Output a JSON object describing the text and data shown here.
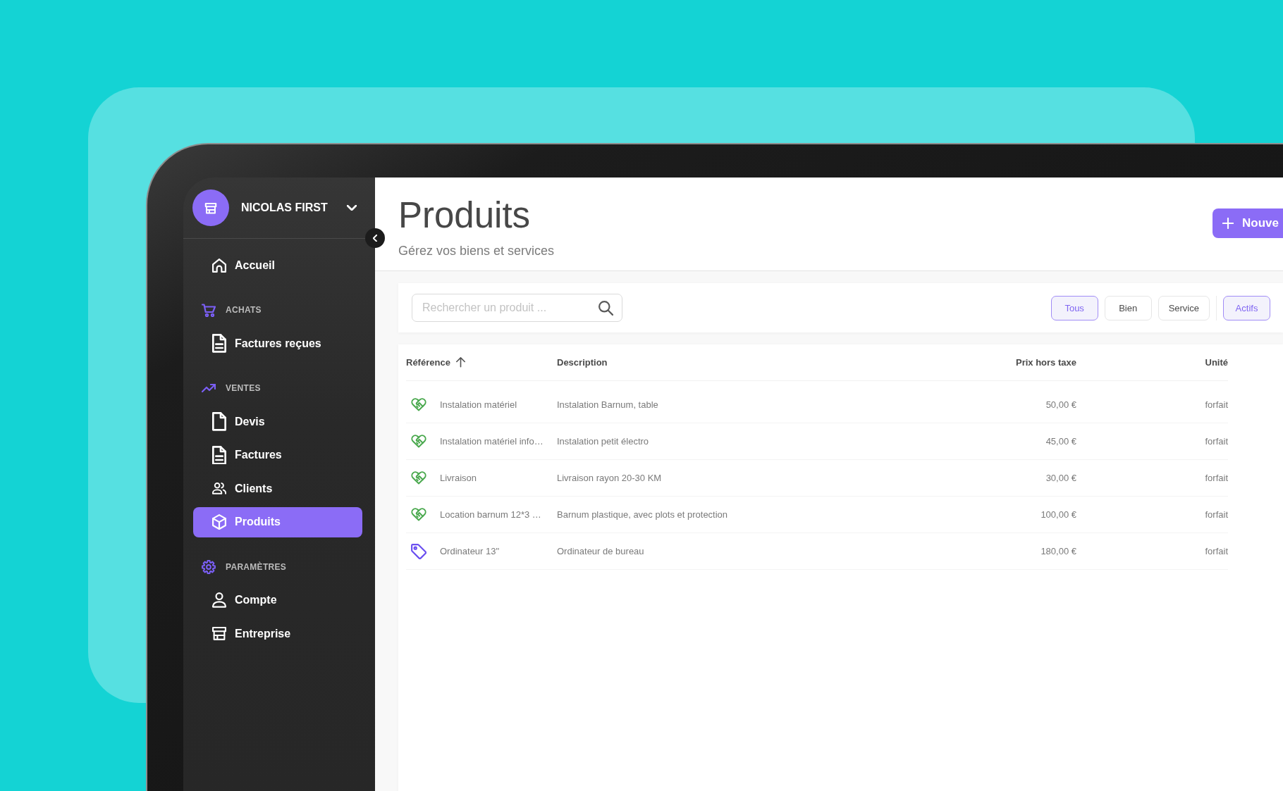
{
  "sidebar": {
    "account": {
      "name": "NICOLAS FIRST"
    },
    "items": [
      {
        "label": "Accueil",
        "selected": false
      }
    ],
    "sections": [
      {
        "title": "ACHATS",
        "items": [
          {
            "label": "Factures reçues",
            "selected": false
          }
        ]
      },
      {
        "title": "VENTES",
        "items": [
          {
            "label": "Devis",
            "selected": false
          },
          {
            "label": "Factures",
            "selected": false
          },
          {
            "label": "Clients",
            "selected": false
          },
          {
            "label": "Produits",
            "selected": true
          }
        ]
      },
      {
        "title": "PARAMÈTRES",
        "items": [
          {
            "label": "Compte",
            "selected": false
          },
          {
            "label": "Entreprise",
            "selected": false
          }
        ]
      }
    ]
  },
  "header": {
    "title": "Produits",
    "subtitle": "Gérez vos biens et services",
    "new_button": {
      "label": "Nouve"
    }
  },
  "filters": {
    "search": {
      "placeholder": "Rechercher un produit ..."
    },
    "type": [
      {
        "label": "Tous",
        "selected": true
      },
      {
        "label": "Bien",
        "selected": false
      },
      {
        "label": "Service",
        "selected": false
      }
    ],
    "status": [
      {
        "label": "Actifs",
        "selected": true
      }
    ]
  },
  "table": {
    "columns": [
      {
        "label": "Référence",
        "sorted": true
      },
      {
        "label": "Description",
        "sorted": false
      },
      {
        "label": "Prix hors taxe",
        "sorted": false
      },
      {
        "label": "Unité",
        "sorted": false
      }
    ],
    "rows": [
      {
        "kind": "service",
        "reference": "Instalation matériel",
        "description": "Instalation Barnum, table",
        "price": "50,00 €",
        "unit": "forfait"
      },
      {
        "kind": "service",
        "reference": "Instalation matériel info…",
        "description": "Instalation petit électro",
        "price": "45,00 €",
        "unit": "forfait"
      },
      {
        "kind": "service",
        "reference": "Livraison",
        "description": "Livraison rayon 20-30 KM",
        "price": "30,00 €",
        "unit": "forfait"
      },
      {
        "kind": "service",
        "reference": "Location barnum 12*3 …",
        "description": "Barnum plastique, avec plots et protection",
        "price": "100,00 €",
        "unit": "forfait"
      },
      {
        "kind": "good",
        "reference": "Ordinateur 13\"",
        "description": "Ordinateur de bureau",
        "price": "180,00 €",
        "unit": "forfait"
      }
    ]
  }
}
